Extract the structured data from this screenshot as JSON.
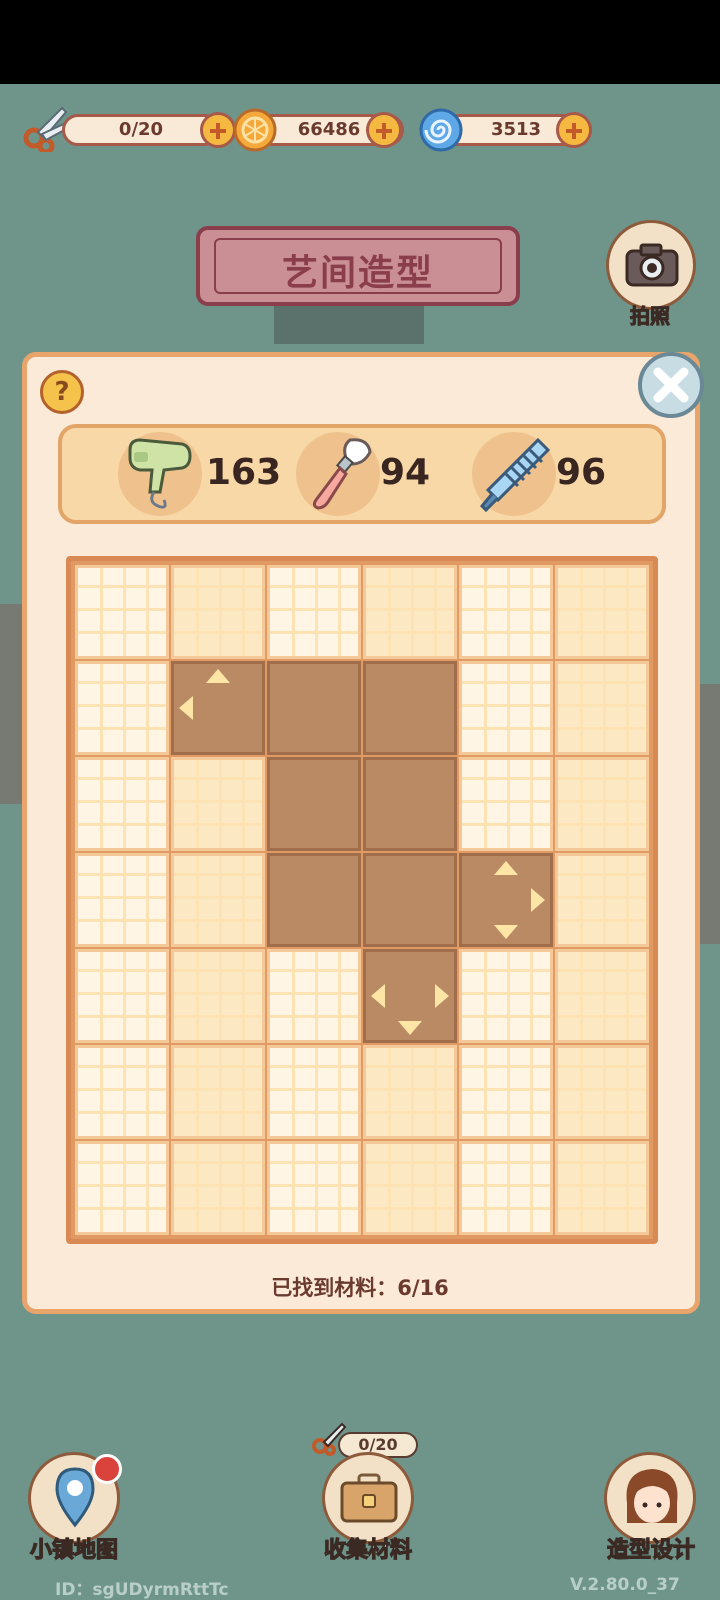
{
  "resources": {
    "scissors_count": "0/20",
    "coins": "66486",
    "gems": "3513"
  },
  "title": "艺间造型",
  "camera": {
    "label": "拍照"
  },
  "tools": [
    {
      "name": "hair-dryer-icon",
      "count": "163"
    },
    {
      "name": "makeup-brush-icon",
      "count": "94"
    },
    {
      "name": "comb-icon",
      "count": "96"
    }
  ],
  "grid": {
    "rows": 7,
    "cols": 6,
    "dug_cells": [
      [
        1,
        1
      ],
      [
        1,
        2
      ],
      [
        1,
        3
      ],
      [
        2,
        2
      ],
      [
        2,
        3
      ],
      [
        3,
        2
      ],
      [
        3,
        3
      ],
      [
        3,
        4
      ],
      [
        4,
        3
      ]
    ]
  },
  "found_text": "已找到材料：6/16",
  "bottom_nav": {
    "map_label": "小镇地图",
    "collect_label": "收集材料",
    "collect_counter": "0/20",
    "design_label": "造型设计"
  },
  "footer": {
    "id": "ID：sgUDyrmRttTc",
    "version": "V.2.80.0_37"
  },
  "colors": {
    "background": "#6f958b",
    "panel": "#fbead7",
    "panel_border": "#e8a46a",
    "dug_cell": "#b98a64",
    "title_banner": "#c98f94"
  }
}
